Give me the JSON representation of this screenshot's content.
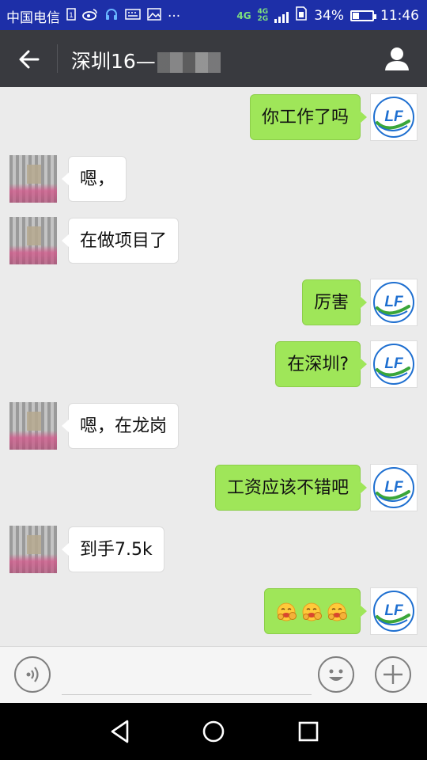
{
  "status_bar": {
    "carrier": "中国电信",
    "network_primary": "4G",
    "network_secondary_top": "4G",
    "network_secondary_bottom": "2G",
    "battery_percent": "34%",
    "battery_level": 0.34,
    "time": "11:46",
    "icons": [
      "sim-icon",
      "weibo-icon",
      "headset-icon",
      "keyboard-icon",
      "gallery-icon",
      "more-dots-icon",
      "signal-icon",
      "sim-status-icon",
      "battery-icon"
    ],
    "more": "···"
  },
  "header": {
    "title": "深圳16—",
    "back_icon": "arrow-left-icon",
    "profile_icon": "person-icon"
  },
  "messages": [
    {
      "sender": "me",
      "text": "你工作了吗"
    },
    {
      "sender": "other",
      "text": "嗯，"
    },
    {
      "sender": "other",
      "text": "在做项目了"
    },
    {
      "sender": "me",
      "text": "厉害"
    },
    {
      "sender": "me",
      "text": "在深圳?"
    },
    {
      "sender": "other",
      "text": "嗯，在龙岗"
    },
    {
      "sender": "me",
      "text": "工资应该不错吧"
    },
    {
      "sender": "other",
      "text": "到手7.5k"
    },
    {
      "sender": "me",
      "text": "",
      "emoji": [
        "money-mouth-emoji",
        "money-mouth-emoji",
        "money-mouth-emoji"
      ]
    }
  ],
  "my_avatar_logo": "LF",
  "input_bar": {
    "placeholder": "",
    "voice_icon": "voice-icon",
    "emoji_icon": "smiley-icon",
    "plus_icon": "plus-icon"
  },
  "nav_bar": {
    "icons": [
      "back-triangle-icon",
      "home-circle-icon",
      "recent-square-icon"
    ]
  },
  "colors": {
    "status_bar": "#1d2fa8",
    "title_bar": "#393a3f",
    "chat_bg": "#ebebeb",
    "my_bubble": "#9fe659",
    "other_bubble": "#ffffff",
    "logo_blue": "#1e6fd0",
    "logo_green": "#3aa63a"
  }
}
